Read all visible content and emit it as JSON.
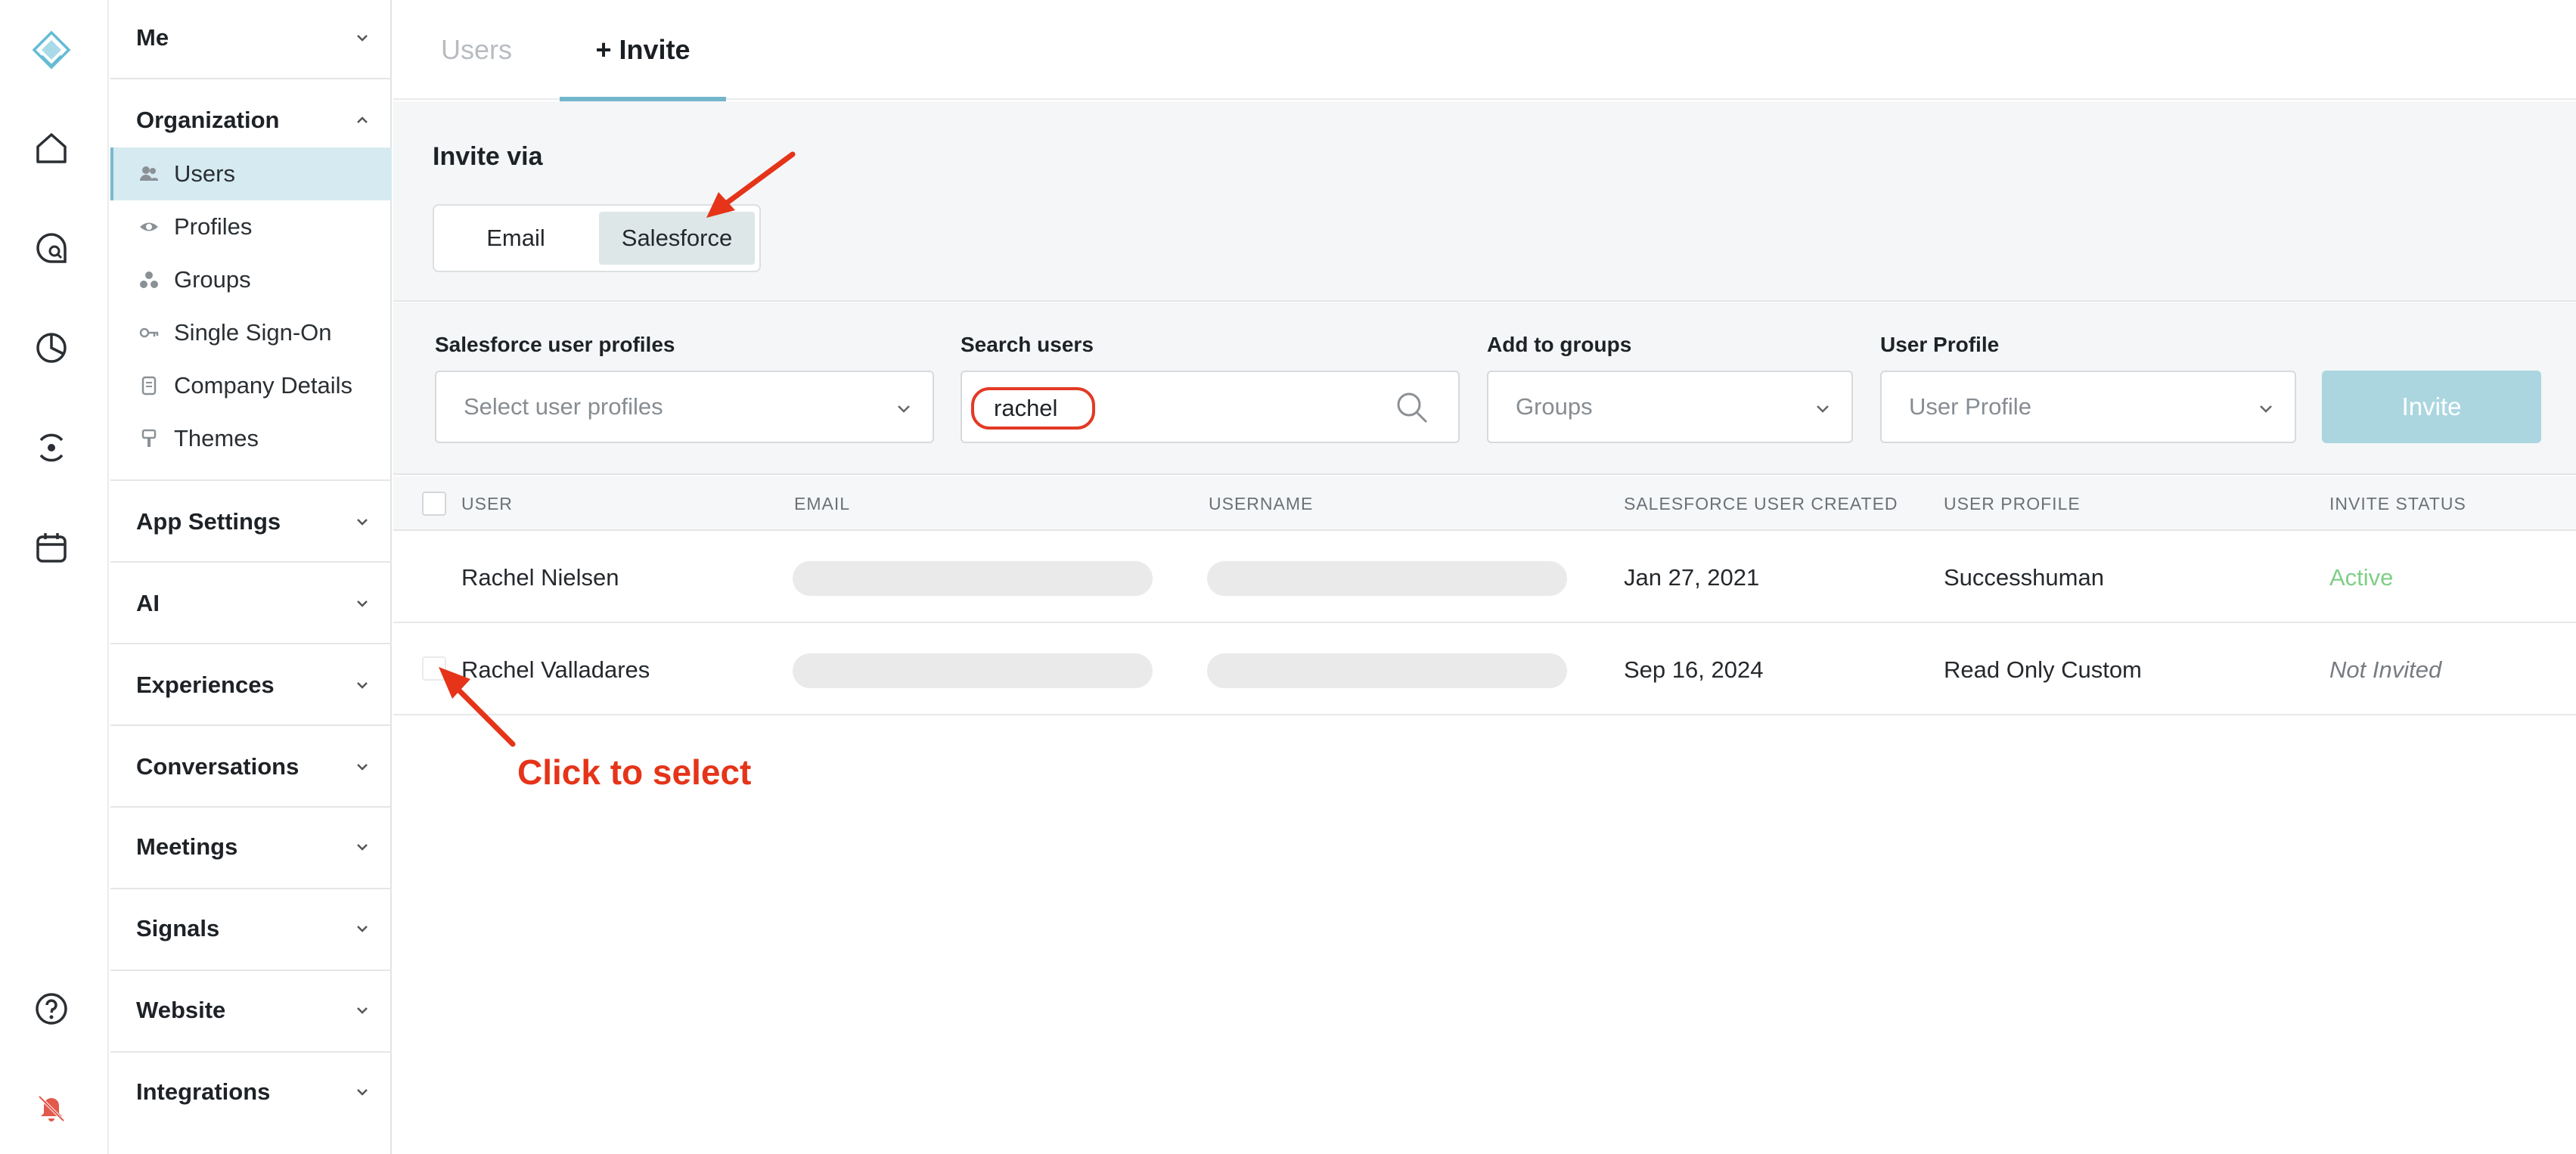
{
  "sidebar": {
    "sections": {
      "me": "Me",
      "organization": "Organization",
      "app_settings": "App Settings",
      "ai": "AI",
      "experiences": "Experiences",
      "conversations": "Conversations",
      "meetings": "Meetings",
      "signals": "Signals",
      "website": "Website",
      "integrations": "Integrations"
    },
    "org_items": {
      "users": "Users",
      "profiles": "Profiles",
      "groups": "Groups",
      "sso": "Single Sign-On",
      "company": "Company Details",
      "themes": "Themes"
    }
  },
  "tabs": {
    "users": "Users",
    "invite": "+ Invite"
  },
  "invite_via": {
    "title": "Invite via",
    "email": "Email",
    "salesforce": "Salesforce"
  },
  "filters": {
    "sf_profiles_label": "Salesforce user profiles",
    "sf_profiles_placeholder": "Select user profiles",
    "search_label": "Search users",
    "search_value": "rachel",
    "groups_label": "Add to groups",
    "groups_placeholder": "Groups",
    "profile_label": "User Profile",
    "profile_placeholder": "User Profile",
    "invite_button": "Invite"
  },
  "table": {
    "headers": {
      "user": "USER",
      "email": "EMAIL",
      "username": "USERNAME",
      "created": "SALESFORCE USER CREATED",
      "profile": "USER PROFILE",
      "status": "INVITE STATUS"
    },
    "rows": [
      {
        "user": "Rachel Nielsen",
        "created": "Jan 27, 2021",
        "profile": "Successhuman",
        "status": "Active"
      },
      {
        "user": "Rachel Valladares",
        "created": "Sep 16, 2024",
        "profile": "Read Only Custom",
        "status": "Not Invited"
      }
    ]
  },
  "annotation": {
    "text": "Click to select"
  },
  "colors": {
    "accent": "#73b6cc",
    "active_nav_bg": "#d6eaf1",
    "annotation_red": "#e53419",
    "active_status": "#7fcf86"
  }
}
